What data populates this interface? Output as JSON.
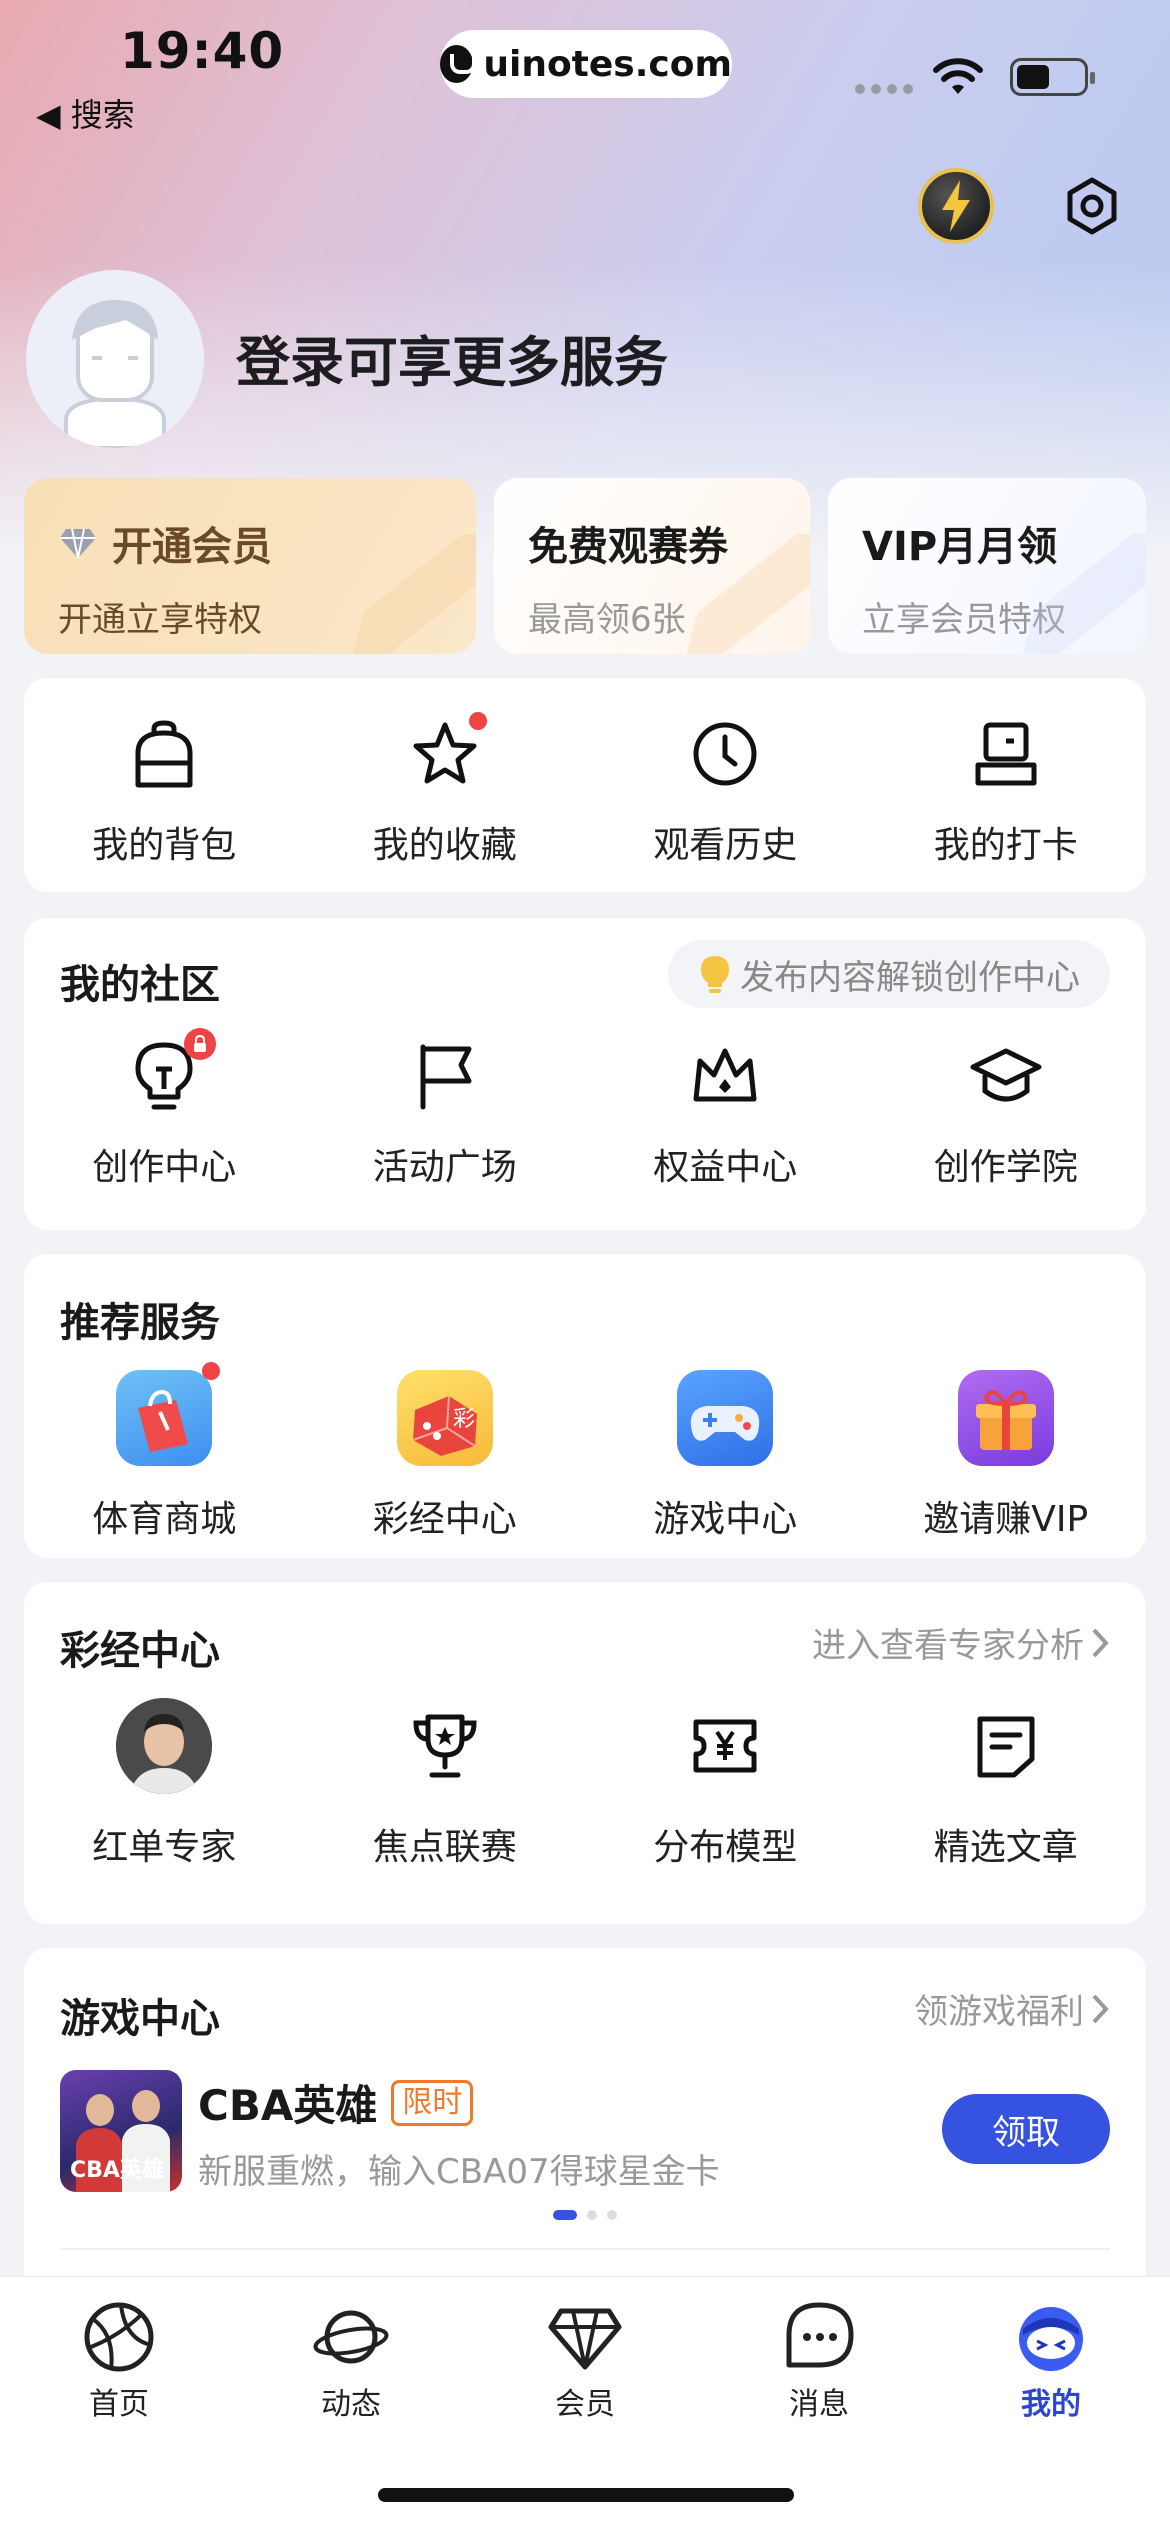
{
  "status_bar": {
    "time": "19:40",
    "back_label": "◀ 搜索",
    "url": "uinotes.com"
  },
  "profile": {
    "login_text": "登录可享更多服务"
  },
  "member_cards": [
    {
      "title": "开通会员",
      "subtitle": "开通立享特权"
    },
    {
      "title": "免费观赛券",
      "subtitle": "最高领6张"
    },
    {
      "title": "VIP月月领",
      "subtitle": "立享会员特权"
    }
  ],
  "quick_actions": [
    {
      "label": "我的背包",
      "icon": "backpack-icon"
    },
    {
      "label": "我的收藏",
      "icon": "star-icon"
    },
    {
      "label": "观看历史",
      "icon": "clock-icon"
    },
    {
      "label": "我的打卡",
      "icon": "checkin-icon"
    }
  ],
  "community": {
    "title": "我的社区",
    "hint": "发布内容解锁创作中心",
    "items": [
      {
        "label": "创作中心",
        "icon": "lightbulb-icon"
      },
      {
        "label": "活动广场",
        "icon": "flag-icon"
      },
      {
        "label": "权益中心",
        "icon": "crown-icon"
      },
      {
        "label": "创作学院",
        "icon": "graduation-cap-icon"
      }
    ]
  },
  "services": {
    "title": "推荐服务",
    "items": [
      {
        "label": "体育商城",
        "icon": "shopping-bag-icon"
      },
      {
        "label": "彩经中心",
        "icon": "lottery-dice-icon"
      },
      {
        "label": "游戏中心",
        "icon": "gamepad-icon"
      },
      {
        "label": "邀请赚VIP",
        "icon": "gift-icon"
      }
    ]
  },
  "lottery": {
    "title": "彩经中心",
    "link": "进入查看专家分析",
    "items": [
      {
        "label": "红单专家",
        "icon": "expert-avatar"
      },
      {
        "label": "焦点联赛",
        "icon": "trophy-icon"
      },
      {
        "label": "分布模型",
        "icon": "ticket-yen-icon"
      },
      {
        "label": "精选文章",
        "icon": "article-icon"
      }
    ]
  },
  "game_center": {
    "title": "游戏中心",
    "link": "领游戏福利",
    "game_name": "CBA英雄",
    "tag": "限时",
    "description": "新服重燃，输入CBA07得球星金卡",
    "claim_label": "领取",
    "thumb_text": "CBA英雄"
  },
  "tab_bar": [
    {
      "label": "首页",
      "icon": "basketball-icon"
    },
    {
      "label": "动态",
      "icon": "planet-icon"
    },
    {
      "label": "会员",
      "icon": "diamond-icon"
    },
    {
      "label": "消息",
      "icon": "message-icon"
    },
    {
      "label": "我的",
      "icon": "mascot-icon",
      "active": true
    }
  ],
  "colors": {
    "accent": "#3552e0",
    "tag_orange": "#f07a2c",
    "badge_red": "#ee4444"
  }
}
